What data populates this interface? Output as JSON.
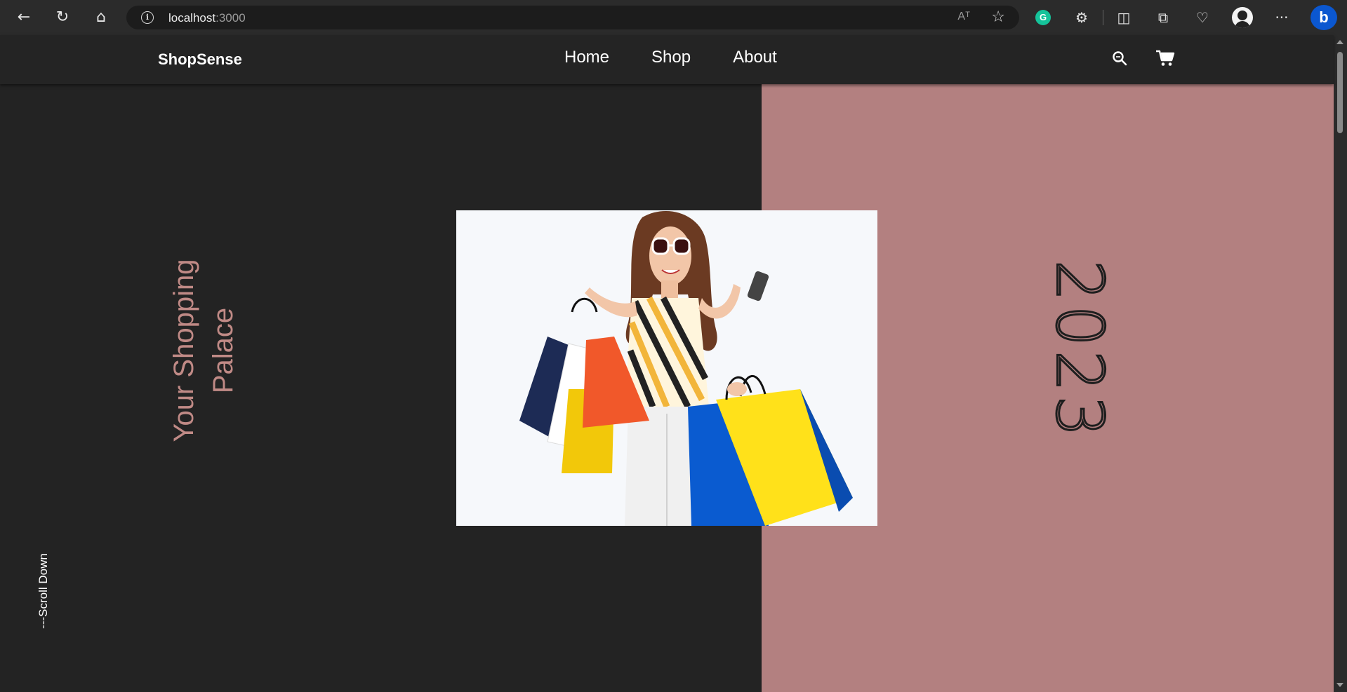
{
  "browser": {
    "url_host": "localhost",
    "url_port": ":3000",
    "info_icon_glyph": "i",
    "read_aloud_glyph": "Aᵀ",
    "favorite_glyph": "☆",
    "grammarly_glyph": "G",
    "bing_glyph": "b",
    "back_glyph": "←",
    "refresh_glyph": "↻",
    "home_glyph": "⌂",
    "extensions_glyph": "⚙",
    "split_glyph": "◫",
    "collections_glyph": "⧉",
    "health_glyph": "♡",
    "more_glyph": "···"
  },
  "site": {
    "brand": "ShopSense",
    "nav": [
      {
        "label": "Home"
      },
      {
        "label": "Shop"
      },
      {
        "label": "About"
      }
    ],
    "icons": {
      "search": "search-icon",
      "cart": "cart-icon"
    }
  },
  "hero": {
    "tagline": "Your Shopping Palace",
    "scroll_hint": "---Scroll Down",
    "year": "2023",
    "left_bg": "#232323",
    "right_bg": "#b38080",
    "tagline_color": "#c08a86"
  }
}
